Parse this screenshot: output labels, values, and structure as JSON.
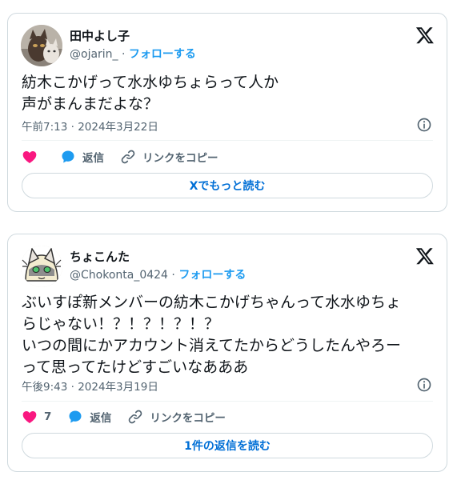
{
  "colors": {
    "accent": "#1d9bf0",
    "like": "#f91880",
    "text": "#0f1419",
    "muted": "#536471",
    "border": "#cfd9de",
    "link": "#006fd6"
  },
  "posts": [
    {
      "display_name": "田中よし子",
      "handle": "@ojarin_",
      "separator": " · ",
      "follow_label": "フォローする",
      "body": "紡木こかげって水水ゆちょらって人か\n声がまんまだよな？",
      "timestamp": "午前7:13 · 2024年3月22日",
      "like_count": "",
      "reply_label": "返信",
      "copy_link_label": "リンクをコピー",
      "footer_button": "Xでもっと読む",
      "icons": [
        "x-logo-icon",
        "info-icon",
        "heart-icon",
        "reply-bubble-icon",
        "link-icon"
      ]
    },
    {
      "display_name": "ちょこんた",
      "handle": "@Chokonta_0424",
      "separator": " · ",
      "follow_label": "フォローする",
      "body": "ぶいすぽ新メンバーの紡木こかげちゃんって水水ゆちょ\nらじゃない！？！？！？！？\nいつの間にかアカウント消えてたからどうしたんやろー\nって思ってたけどすごいなあああ",
      "timestamp": "午後9:43 · 2024年3月19日",
      "like_count": "7",
      "reply_label": "返信",
      "copy_link_label": "リンクをコピー",
      "footer_button": "1件の返信を読む",
      "icons": [
        "x-logo-icon",
        "info-icon",
        "heart-icon",
        "reply-bubble-icon",
        "link-icon"
      ]
    }
  ]
}
